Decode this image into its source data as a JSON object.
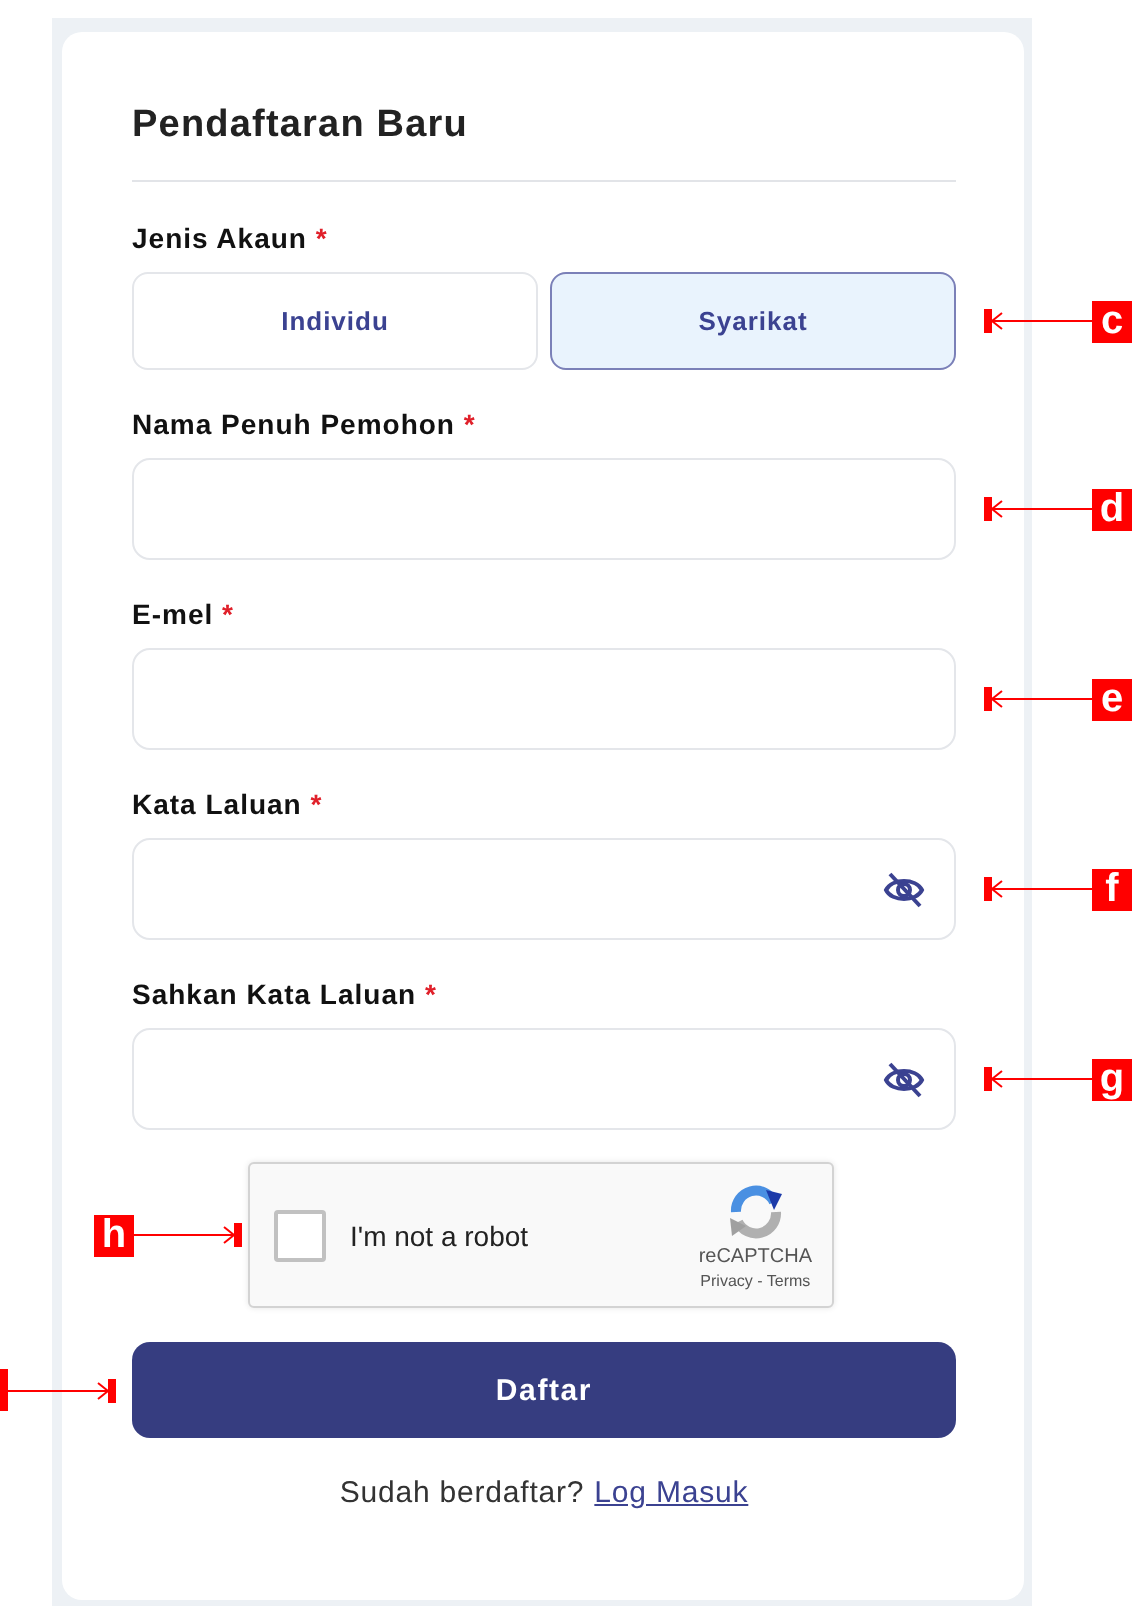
{
  "title": "Pendaftaran Baru",
  "account_type": {
    "label": "Jenis Akaun",
    "required_mark": "*",
    "options": [
      {
        "label": "Individu",
        "selected": false
      },
      {
        "label": "Syarikat",
        "selected": true
      }
    ],
    "callout": {
      "label": "c",
      "kind": "right"
    }
  },
  "fields": [
    {
      "kind": "text",
      "label": "Nama Penuh Pemohon",
      "required_mark": "*",
      "callout": {
        "label": "d",
        "kind": "right"
      }
    },
    {
      "kind": "text",
      "label": "E-mel",
      "required_mark": "*",
      "callout": {
        "label": "e",
        "kind": "right"
      }
    },
    {
      "kind": "password",
      "label": "Kata Laluan",
      "required_mark": "*",
      "callout": {
        "label": "f",
        "kind": "right"
      }
    },
    {
      "kind": "password",
      "label": "Sahkan Kata Laluan",
      "required_mark": "*",
      "callout": {
        "label": "g",
        "kind": "right"
      }
    }
  ],
  "captcha": {
    "label": "I'm not a robot",
    "checked": false,
    "brand": "reCAPTCHA",
    "links": "Privacy - Terms",
    "callout": {
      "label": "h",
      "kind": "left"
    }
  },
  "submit": {
    "label": "Daftar",
    "callout": {
      "kind": "left"
    }
  },
  "login_prompt": {
    "text": "Sudah berdaftar?",
    "link": "Log Masuk"
  }
}
